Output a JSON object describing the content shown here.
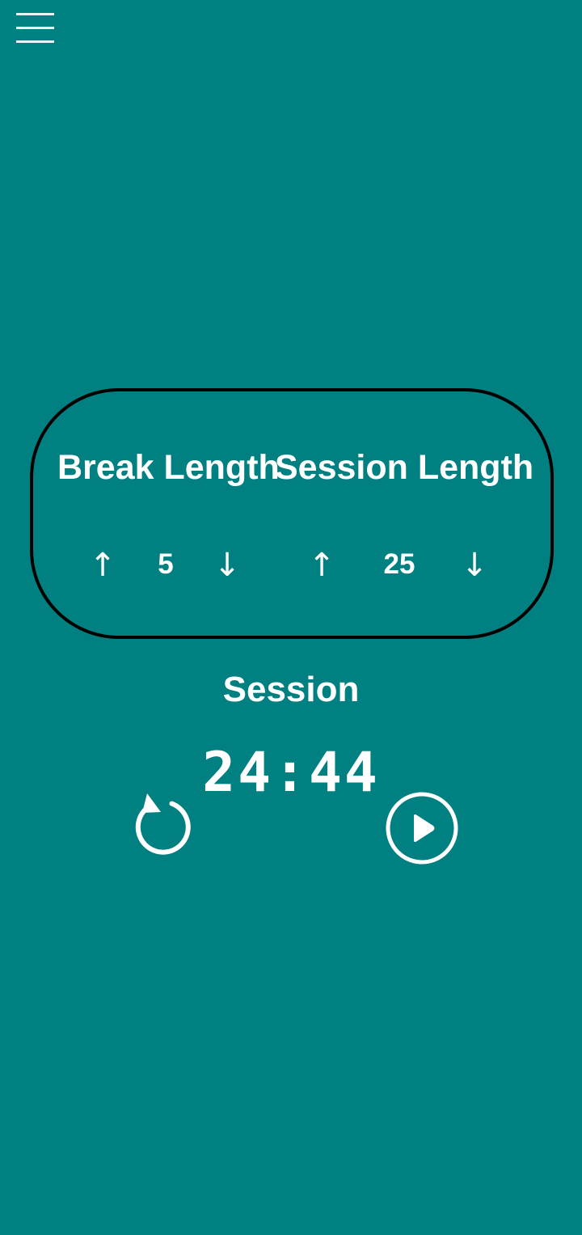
{
  "header": {
    "menu_icon": "hamburger-menu-icon"
  },
  "settings": {
    "break": {
      "label": "Break Length",
      "increment_glyph": "↑",
      "value": "5",
      "decrement_glyph": "↓"
    },
    "session": {
      "label": "Session Length",
      "increment_glyph": "↑",
      "value": "25",
      "decrement_glyph": "↓"
    }
  },
  "timer": {
    "label": "Session",
    "time": "24:44"
  },
  "controls": {
    "reset_icon": "reset-icon",
    "play_icon": "play-icon"
  },
  "colors": {
    "background": "#008080",
    "foreground": "#ffffff",
    "card_border": "#000000"
  }
}
